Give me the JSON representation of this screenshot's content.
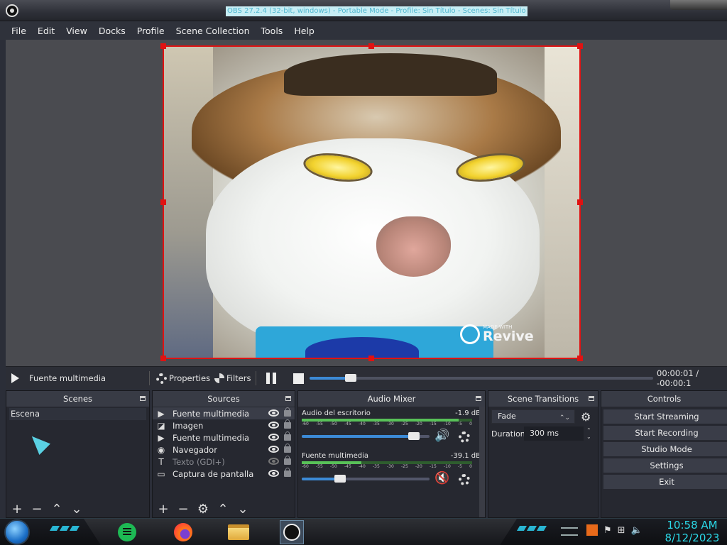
{
  "window": {
    "title": "OBS 27.2.4 (32-bit, windows) - Portable Mode - Profile: Sin Título - Scenes: Sin Título"
  },
  "menu": [
    "File",
    "Edit",
    "View",
    "Docks",
    "Profile",
    "Scene Collection",
    "Tools",
    "Help"
  ],
  "preview": {
    "watermark_small": "MADE WITH",
    "watermark_big": "Revive"
  },
  "transport": {
    "source_name": "Fuente multimedia",
    "properties_label": "Properties",
    "filters_label": "Filters",
    "time": "00:00:01 / -00:00:1",
    "progress": 0.12
  },
  "docks": {
    "scenes": {
      "title": "Scenes",
      "items": [
        "Escena"
      ]
    },
    "sources": {
      "title": "Sources",
      "items": [
        {
          "name": "Fuente multimedia",
          "icon": "play-icon",
          "visible": true
        },
        {
          "name": "Imagen",
          "icon": "image-icon",
          "visible": true
        },
        {
          "name": "Fuente multimedia",
          "icon": "play-icon",
          "visible": true
        },
        {
          "name": "Navegador",
          "icon": "globe-icon",
          "visible": true
        },
        {
          "name": "Texto (GDI+)",
          "icon": "text-icon",
          "visible": false
        },
        {
          "name": "Captura de pantalla",
          "icon": "monitor-icon",
          "visible": true
        }
      ]
    },
    "mixer": {
      "title": "Audio Mixer",
      "scale": [
        "-60",
        "-55",
        "-50",
        "-45",
        "-40",
        "-35",
        "-30",
        "-25",
        "-20",
        "-15",
        "-10",
        "-5",
        "0"
      ],
      "channels": [
        {
          "name": "Audio del escritorio",
          "db": "-1.9 dB",
          "volume": 0.88,
          "level": 0.92,
          "muted": false
        },
        {
          "name": "Fuente multimedia",
          "db": "-39.1 dB",
          "volume": 0.3,
          "level": 0.35,
          "muted": true
        }
      ]
    },
    "transitions": {
      "title": "Scene Transitions",
      "selected": "Fade",
      "duration_label": "Duration",
      "duration_value": "300 ms"
    },
    "controls": {
      "title": "Controls",
      "buttons": [
        "Start Streaming",
        "Start Recording",
        "Studio Mode",
        "Settings",
        "Exit"
      ]
    }
  },
  "taskbar": {
    "time": "10:58 AM",
    "date": "8/12/2023"
  },
  "colors": {
    "accent": "#3c8ad6",
    "selection": "#e01212",
    "clock": "#2bd9e8"
  }
}
